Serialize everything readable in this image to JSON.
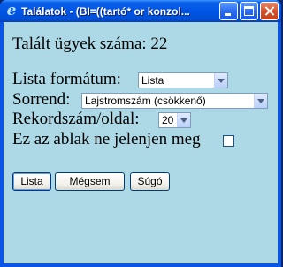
{
  "window": {
    "title": "Találatok - (BI=((tartó* or konzol...",
    "icon": "internet-explorer-icon"
  },
  "results": {
    "count_label": "Talált ügyek száma: 22"
  },
  "form": {
    "format_label": "Lista formátum:",
    "format_value": "Lista",
    "sort_label": "Sorrend:",
    "sort_value": "Lajstromszám (csökkenő)",
    "records_label": "Rekordszám/oldal:",
    "records_value": "20",
    "hide_window_label": "Ez az ablak ne jelenjen meg",
    "hide_window_checked": false
  },
  "buttons": {
    "list": "Lista",
    "cancel": "Mégsem",
    "help": "Súgó"
  },
  "colors": {
    "background": "#add8e6",
    "titlebar": "#0055e5"
  }
}
